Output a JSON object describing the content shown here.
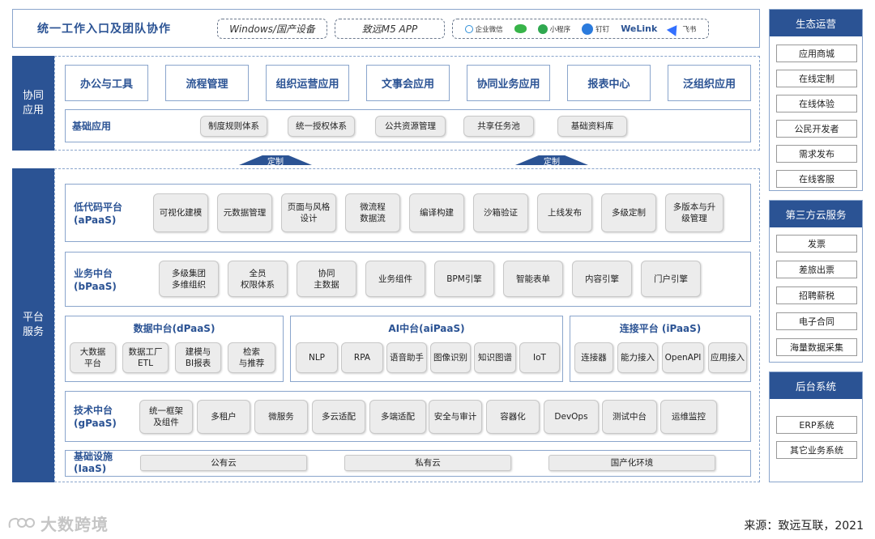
{
  "header": {
    "title": "统一工作入口及团队协作",
    "entry_windows": "Windows/国产设备",
    "entry_app": "致远M5 APP",
    "clients": [
      {
        "label": "企业微信",
        "color": "#2f8fd8"
      },
      {
        "label": "",
        "color": "#38b449"
      },
      {
        "label": "小程序",
        "color": "#2fa84f"
      },
      {
        "label": "钉钉",
        "color": "#2b7bdd"
      },
      {
        "label": "WeLink",
        "color": "#2b5394"
      },
      {
        "label": "飞书",
        "color": "#3370ff"
      }
    ]
  },
  "collab": {
    "label": "协同\n应用",
    "apps": [
      "办公与工具",
      "流程管理",
      "组织运营应用",
      "文事会应用",
      "协同业务应用",
      "报表中心",
      "泛组织应用"
    ],
    "base_title": "基础应用",
    "base_items": [
      "制度规则体系",
      "统一授权体系",
      "公共资源管理",
      "共享任务池",
      "基础资料库"
    ]
  },
  "arrows": [
    "定制",
    "定制"
  ],
  "platform": {
    "label": "平台\n服务",
    "apaas": {
      "title": "低代码平台\n(aPaaS)",
      "items": [
        "可视化建模",
        "元数据管理",
        "页面与风格\n设计",
        "微流程\n数据流",
        "编译构建",
        "沙箱验证",
        "上线发布",
        "多级定制",
        "多版本与升\n级管理"
      ]
    },
    "bpaas": {
      "title": "业务中台\n(bPaaS)",
      "items": [
        "多级集团\n多维组织",
        "全员\n权限体系",
        "协同\n主数据",
        "业务组件",
        "BPM引擎",
        "智能表单",
        "内容引擎",
        "门户引擎"
      ]
    },
    "dpaas": {
      "title": "数据中台(dPaaS)",
      "items": [
        "大数据\n平台",
        "数据工厂\nETL",
        "建模与\nBI报表",
        "检索\n与推荐"
      ]
    },
    "aipaas": {
      "title": "AI中台(aiPaaS)",
      "items": [
        "NLP",
        "RPA",
        "语音助手",
        "图像识别",
        "知识图谱",
        "IoT"
      ]
    },
    "ipaas": {
      "title": "连接平台 (iPaaS)",
      "items": [
        "连接器",
        "能力接入",
        "OpenAPI",
        "应用接入"
      ]
    },
    "gpaas": {
      "title": "技术中台\n(gPaaS)",
      "items": [
        "统一框架\n及组件",
        "多租户",
        "微服务",
        "多云适配",
        "多端适配",
        "安全与审计",
        "容器化",
        "DevOps",
        "测试中台",
        "运维监控"
      ]
    },
    "iaas": {
      "title": "基础设施\n(IaaS)",
      "items": [
        "公有云",
        "私有云",
        "国产化环境"
      ]
    }
  },
  "sidebar": {
    "eco": {
      "title": "生态运营",
      "items": [
        "应用商城",
        "在线定制",
        "在线体验",
        "公民开发者",
        "需求发布",
        "在线客服"
      ]
    },
    "cloud": {
      "title": "第三方云服务",
      "items": [
        "发票",
        "差旅出票",
        "招聘薪税",
        "电子合同",
        "海量数据采集"
      ]
    },
    "backend": {
      "title": "后台系统",
      "items": [
        "ERP系统",
        "其它业务系统"
      ]
    }
  },
  "footer": {
    "watermark": "大数跨境",
    "source": "来源：致远互联，2021"
  }
}
